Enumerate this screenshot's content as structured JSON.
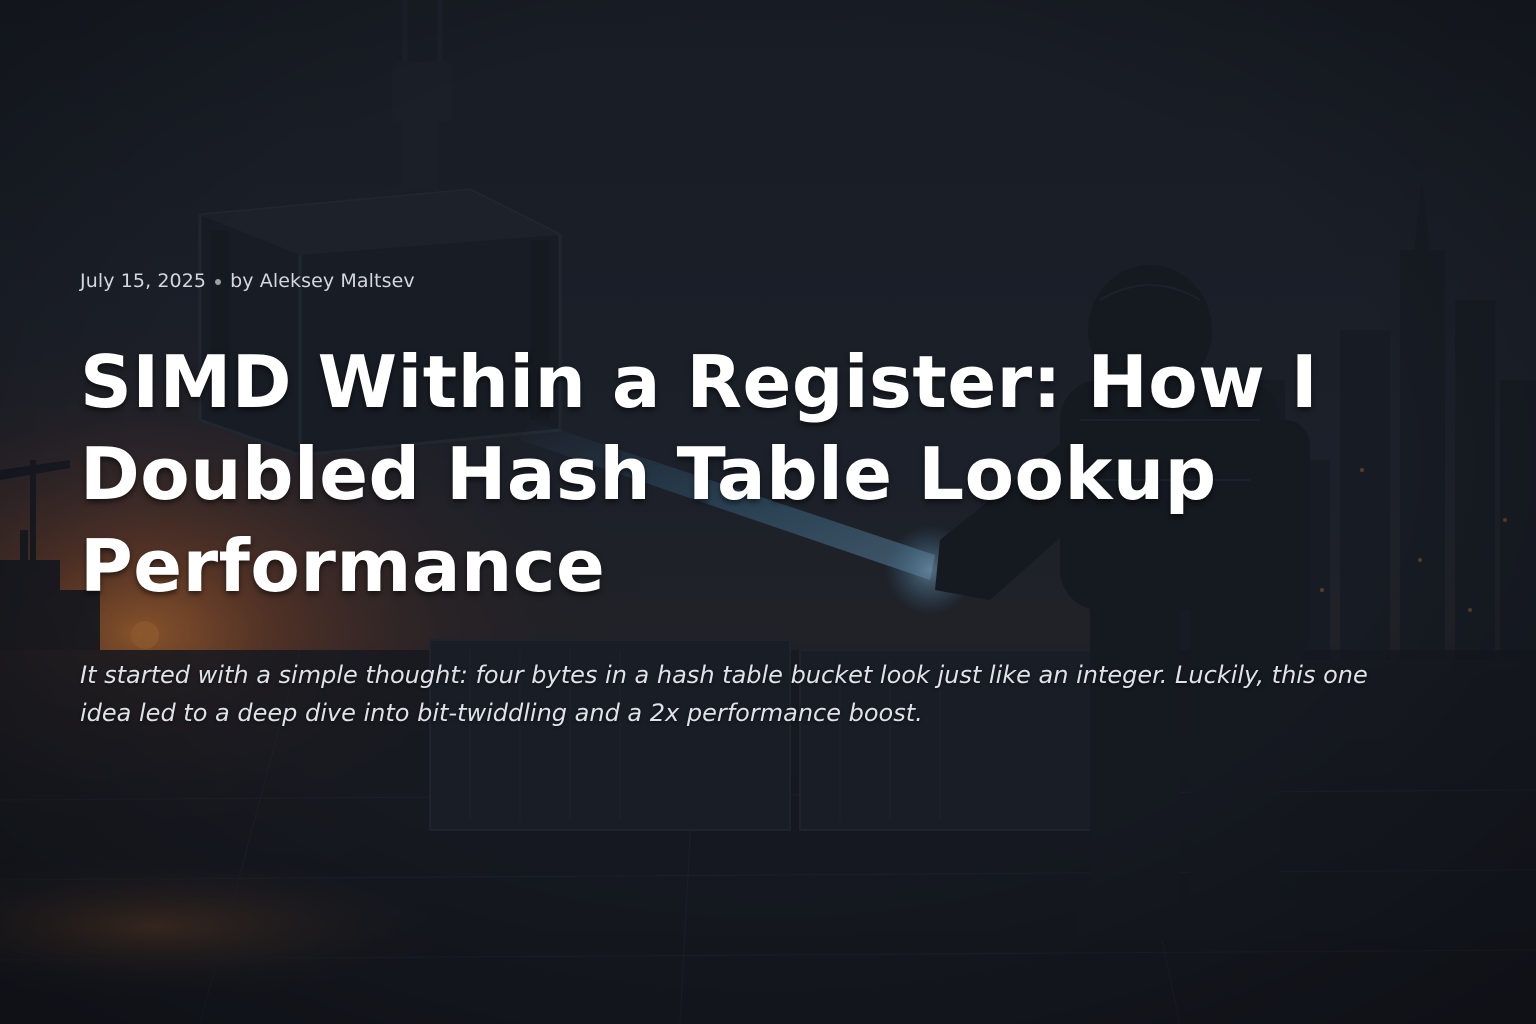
{
  "article": {
    "date": "July 15, 2025",
    "author_line": "by Aleksey Maltsev",
    "title": "SIMD Within a Register: How I Doubled Hash Table Lookup Performance",
    "subtitle": "It started with a simple thought: four bytes in a hash table bucket look just like an integer. Luckily, this one idea led to a deep dive into bit-twiddling and a 2x performance boost."
  },
  "hero_image": {
    "description_icon": "robot-crane-container-harbor-illustration"
  },
  "colors": {
    "sky_dark": "#1b2029",
    "sunset_orange": "#c96a2a",
    "glow_blue": "#4fa3d8",
    "text_primary": "#ffffff",
    "text_meta": "#d4d7dd"
  }
}
